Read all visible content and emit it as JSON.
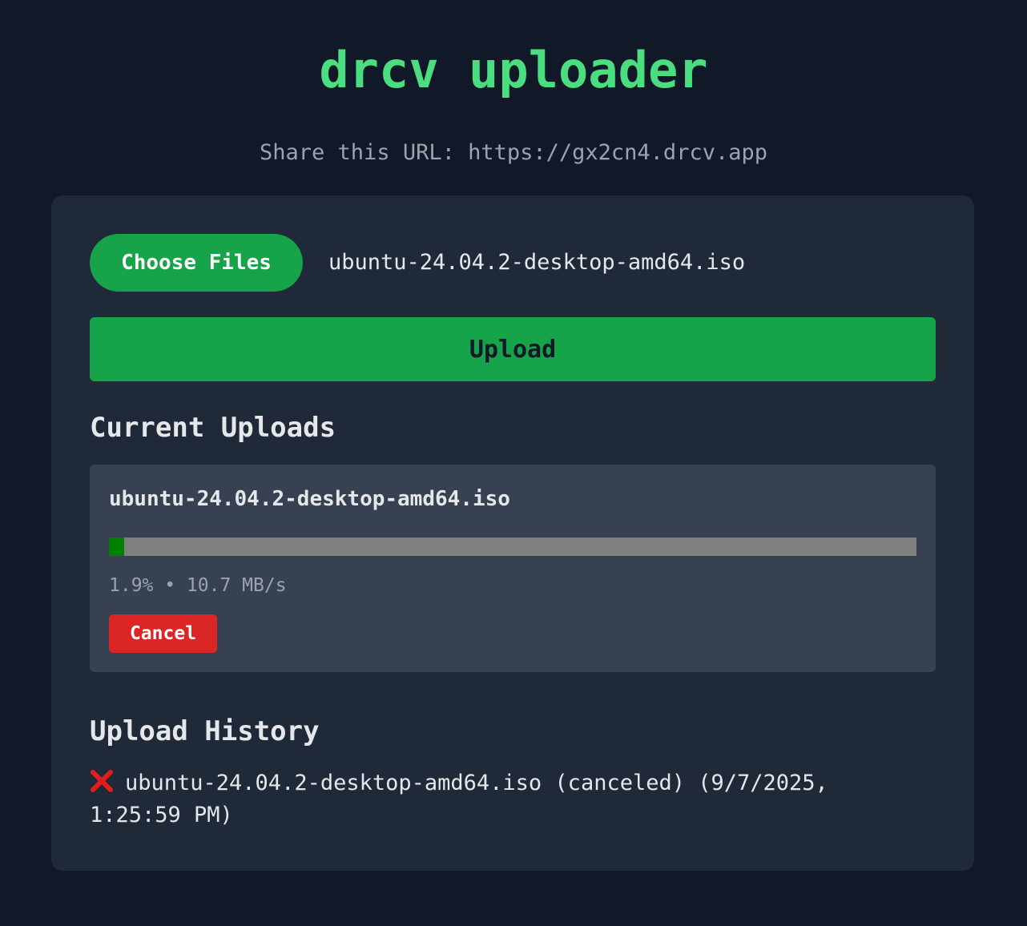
{
  "header": {
    "title": "drcv uploader",
    "share_url": "Share this URL: https://gx2cn4.drcv.app"
  },
  "file_picker": {
    "button_label": "Choose Files",
    "selected_file": "ubuntu-24.04.2-desktop-amd64.iso"
  },
  "upload_button_label": "Upload",
  "current_uploads": {
    "heading": "Current Uploads",
    "items": [
      {
        "filename": "ubuntu-24.04.2-desktop-amd64.iso",
        "progress_percent": 1.9,
        "stats": "1.9% • 10.7 MB/s",
        "cancel_label": "Cancel"
      }
    ]
  },
  "history": {
    "heading": "Upload History",
    "items": [
      {
        "status_icon": "cross-icon",
        "text": "ubuntu-24.04.2-desktop-amd64.iso (canceled) (9/7/2025, 1:25:59 PM)"
      }
    ]
  },
  "colors": {
    "accent": "#4ade80",
    "button": "#16a34a",
    "progress_fill": "#008000",
    "progress_track": "#808080",
    "danger": "#dc2626",
    "background": "#111827",
    "panel": "#1f2937",
    "card": "#374151"
  }
}
